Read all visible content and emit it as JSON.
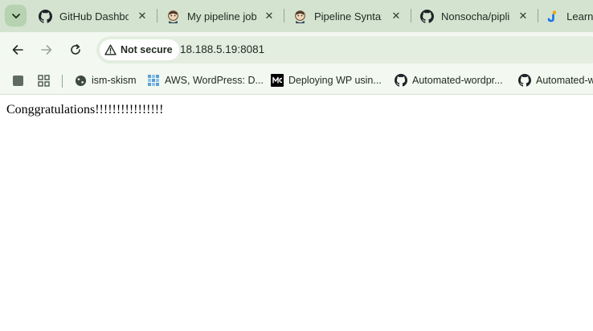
{
  "tabs": [
    {
      "title": "GitHub Dashboard",
      "icon": "github-icon"
    },
    {
      "title": "My pipeline job",
      "icon": "jenkins-icon"
    },
    {
      "title": "Pipeline Syntax",
      "icon": "jenkins-icon"
    },
    {
      "title": "Nonsocha/pipline",
      "icon": "github-icon"
    },
    {
      "title": "Learni",
      "icon": "learning-icon"
    }
  ],
  "toolbar": {
    "security_label": "Not secure",
    "url": "18.188.5.19:8081"
  },
  "bookmarks": [
    {
      "label": "ism-skism",
      "icon": "globe-icon"
    },
    {
      "label": "AWS, WordPress: D...",
      "icon": "aws-icon"
    },
    {
      "label": "Deploying WP usin...",
      "icon": "medium-icon"
    },
    {
      "label": "Automated-wordpr...",
      "icon": "github-icon"
    },
    {
      "label": "Automated-w",
      "icon": "github-icon"
    }
  ],
  "page": {
    "message": "Conggratulations!!!!!!!!!!!!!!!!"
  }
}
